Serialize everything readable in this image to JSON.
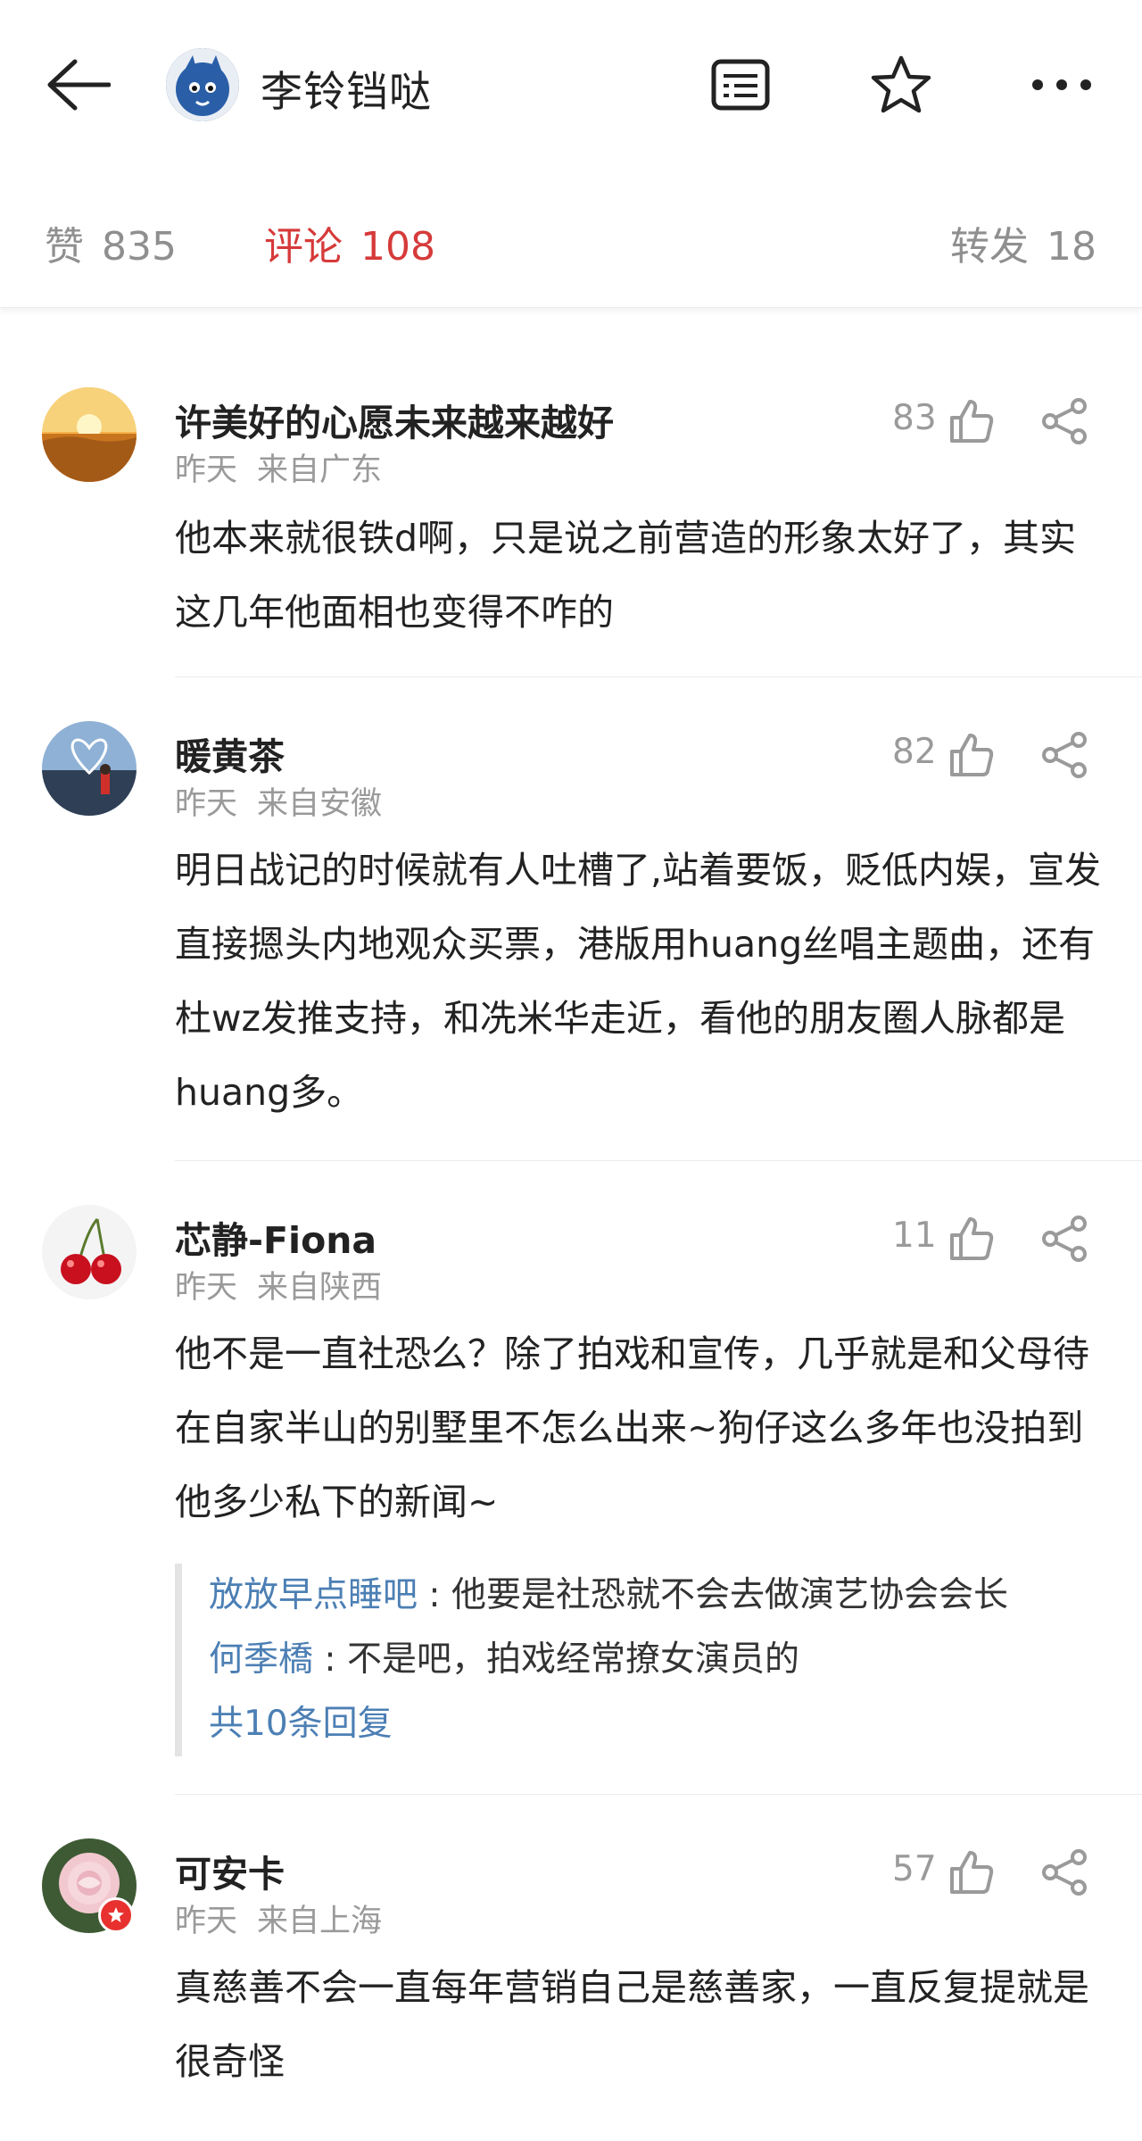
{
  "header": {
    "title": "李铃铛哒",
    "avatar_icon": "cartoon-avatar-icon",
    "back_icon": "back-arrow-icon",
    "doc_icon": "document-icon",
    "star_icon": "star-icon",
    "more_icon": "more-icon"
  },
  "stats": {
    "likes_label": "赞",
    "likes_count": "835",
    "comments_label": "评论",
    "comments_count": "108",
    "reposts_label": "转发",
    "reposts_count": "18",
    "active_color": "#d63a3a"
  },
  "comments": [
    {
      "name": "许美好的心愿未来越来越好",
      "time": "昨天",
      "location": "来自广东",
      "likes": "83",
      "text": "他本来就很铁d啊，只是说之前营造的形象太好了，其实这几年他面相也变得不咋的"
    },
    {
      "name": "暖黄茶",
      "time": "昨天",
      "location": "来自安徽",
      "likes": "82",
      "text": "明日战记的时候就有人吐槽了,站着要饭，贬低内娱，宣发直接摁头内地观众买票，港版用huang丝唱主题曲，还有杜wz发推支持，和冼米华走近，看他的朋友圈人脉都是huang多。"
    },
    {
      "name": "芯静-Fiona",
      "time": "昨天",
      "location": "来自陕西",
      "likes": "11",
      "text": "他不是一直社恐么？除了拍戏和宣传，几乎就是和父母待在自家半山的别墅里不怎么出来~狗仔这么多年也没拍到他多少私下的新闻~",
      "replies": [
        {
          "name": "放放早点睡吧",
          "sep": " : ",
          "text": "他要是社恐就不会去做演艺协会会长"
        },
        {
          "name": "何季橋",
          "sep": " : ",
          "text": "不是吧，拍戏经常撩女演员的"
        }
      ],
      "more_replies": "共10条回复"
    },
    {
      "name": "可安卡",
      "time": "昨天",
      "location": "来自上海",
      "likes": "57",
      "text": "真慈善不会一直每年营销自己是慈善家，一直反复提就是很奇怪"
    }
  ]
}
